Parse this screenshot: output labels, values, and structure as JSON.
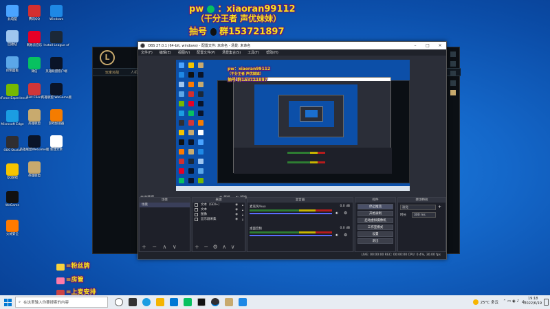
{
  "desktop": {
    "icons": [
      {
        "label": "此电脑",
        "color": "#4aa3ff"
      },
      {
        "label": "Windows",
        "color": "#1e88e5"
      },
      {
        "label": "回收站",
        "color": "#9fc6ef"
      },
      {
        "label": "控制面板",
        "color": "#5ba7e8"
      },
      {
        "label": "GeForce Experience",
        "color": "#76b900"
      },
      {
        "label": "Microsoft Edge",
        "color": "#1b9de2"
      },
      {
        "label": "OBS Studio",
        "color": "#302e31"
      },
      {
        "label": "QQ游戏",
        "color": "#f5c400"
      },
      {
        "label": "WeGame",
        "color": "#111111"
      },
      {
        "label": "火绒安全",
        "color": "#ff7a00"
      },
      {
        "label": "腾讯QQ",
        "color": "#d32f2f"
      },
      {
        "label": "网易云音乐",
        "color": "#e60026"
      },
      {
        "label": "微信",
        "color": "#07c160"
      },
      {
        "label": "Riot Client",
        "color": "#d13639"
      },
      {
        "label": "英雄联盟",
        "color": "#c8aa6e"
      },
      {
        "label": "英雄联盟WeGame版",
        "color": "#0a1428"
      },
      {
        "label": "英雄联盟",
        "color": "#c8aa6e"
      },
      {
        "label": "Install League of",
        "color": "#1b2838"
      },
      {
        "label": "英雄联盟客户端",
        "color": "#0a1428"
      },
      {
        "label": "英雄联盟 WeGame版",
        "color": "#0a1428"
      },
      {
        "label": "游戏加速器",
        "color": "#f57c00"
      },
      {
        "label": "新建文本",
        "color": "#ffffff"
      }
    ]
  },
  "overlay": {
    "line1": "pw",
    "line1_id": "：xiaoran99112",
    "line2": "（干分王者 声优妹妹）",
    "line3": "抽号",
    "line3_group": "群153721897",
    "stickers": [
      "=粉丝牌",
      "=房管",
      "=上麦安排"
    ]
  },
  "launcher": {
    "logo": "L",
    "nav": [
      "玩家对战",
      "人机"
    ]
  },
  "obs": {
    "title": "OBS 27.0.1 (64-bit, windows) - 配置文件: 未命名 - 场景: 未命名",
    "menu": [
      "文件(F)",
      "编辑(E)",
      "视图(V)",
      "配置文件(P)",
      "场景集合(S)",
      "工具(T)",
      "帮助(H)"
    ],
    "scene_label": "未选择源",
    "props": "属性",
    "filters": "滤镜",
    "docks": {
      "scenes": {
        "title": "场景",
        "items": [
          "场景"
        ]
      },
      "sources": {
        "title": "来源",
        "items": [
          "文本（GDI+）",
          "文本",
          "图像",
          "显示器采集"
        ]
      },
      "mixer": {
        "title": "混音器",
        "tracks": [
          {
            "name": "麦克风/Aux",
            "db": "0.0 dB"
          },
          {
            "name": "桌面音频",
            "db": "0.0 dB"
          }
        ]
      },
      "controls": {
        "title": "控件",
        "buttons": [
          "停止推流",
          "开始录制",
          "启动虚拟摄像机",
          "工作室模式",
          "设置",
          "退出"
        ]
      },
      "transitions": {
        "title": "转场特效",
        "type": "淡化",
        "duration_label": "时长",
        "duration": "300 ms"
      }
    },
    "status": "LIVE: 00:00:00    REC: 00:00:00    CPU: 0.4%, 30.00 fps"
  },
  "taskbar": {
    "search_placeholder": "在这里输入你要搜索的内容",
    "weather": "25°C 多云",
    "ime": "中",
    "time": "19:18",
    "date": "2022/6/19"
  }
}
